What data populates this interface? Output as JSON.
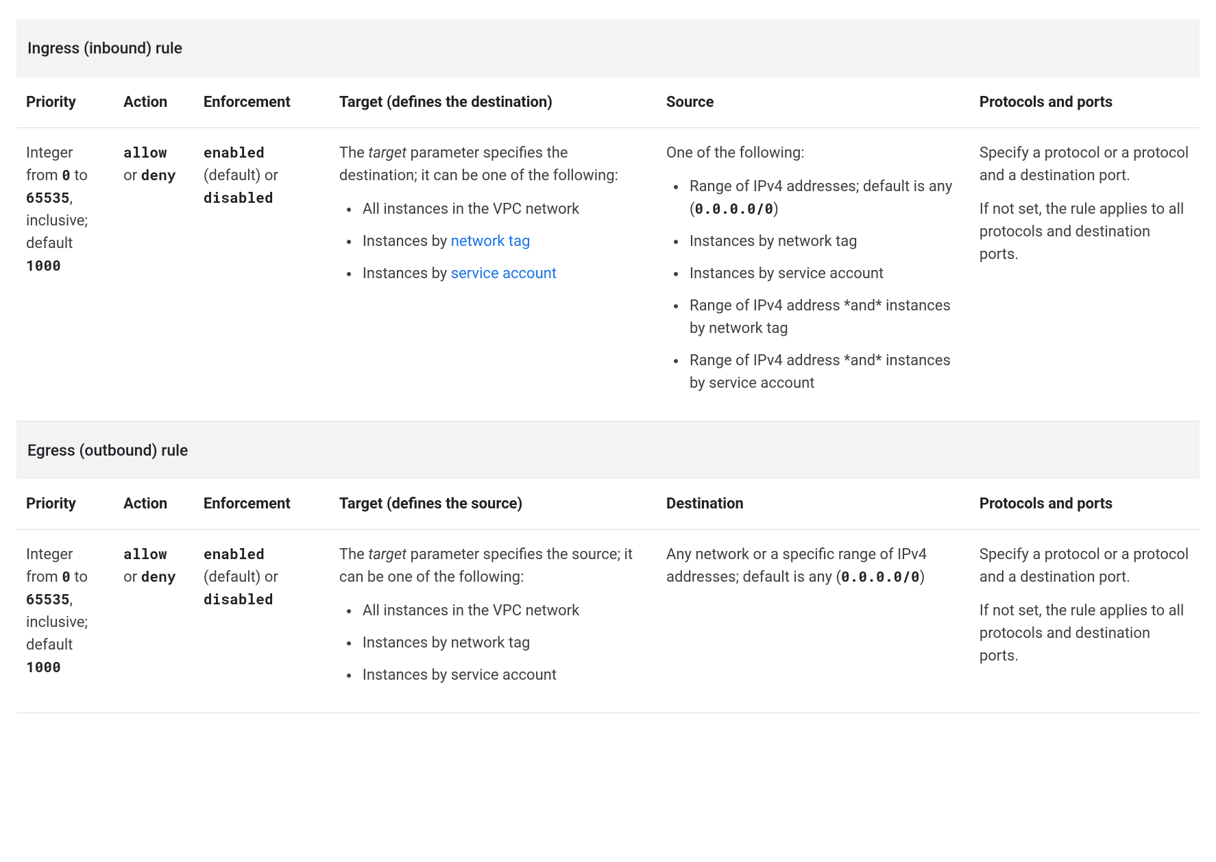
{
  "common": {
    "headers": {
      "priority": "Priority",
      "action": "Action",
      "enforcement": "Enforcement",
      "protocols": "Protocols and ports"
    },
    "priority": {
      "prefix": "Integer from ",
      "min": "0",
      "mid": " to ",
      "max": "65535",
      "suffix": ", inclusive; default ",
      "default": "1000"
    },
    "action": {
      "allow": "allow",
      "or": " or ",
      "deny": "deny"
    },
    "enforcement": {
      "enabled": "enabled",
      "default": " (default) or ",
      "disabled": "disabled"
    },
    "target": {
      "prefix": "The ",
      "italic": "target",
      "li1": "All instances in the VPC network",
      "li2_prefix": "Instances by ",
      "li2_link": "network tag",
      "li2_plain": "Instances by network tag",
      "li3_prefix": "Instances by ",
      "li3_link": "service account",
      "li3_plain": "Instances by service account"
    },
    "protocols": {
      "p1": "Specify a protocol or a protocol and a destination port.",
      "p2": "If not set, the rule applies to all protocols and destination ports."
    }
  },
  "ingress": {
    "title": "Ingress (inbound) rule",
    "headers": {
      "target": "Target (defines the destination)",
      "scope": "Source"
    },
    "target_rest": " parameter specifies the destination; it can be one of the following:",
    "source": {
      "intro": "One of the following:",
      "li1_pre": "Range of IPv4 addresses; default is any (",
      "li1_code": "0.0.0.0/0",
      "li1_post": ")",
      "li2": "Instances by network tag",
      "li3": "Instances by service account",
      "li4": "Range of IPv4 address *and* instances by network tag",
      "li5": "Range of IPv4 address *and* instances by service account"
    }
  },
  "egress": {
    "title": "Egress (outbound) rule",
    "headers": {
      "target": "Target (defines the source)",
      "scope": "Destination"
    },
    "target_rest": " parameter specifies the source; it can be one of the following:",
    "destination": {
      "pre": "Any network or a specific range of IPv4 addresses; default is any (",
      "code": "0.0.0.0/0",
      "post": ")"
    }
  }
}
